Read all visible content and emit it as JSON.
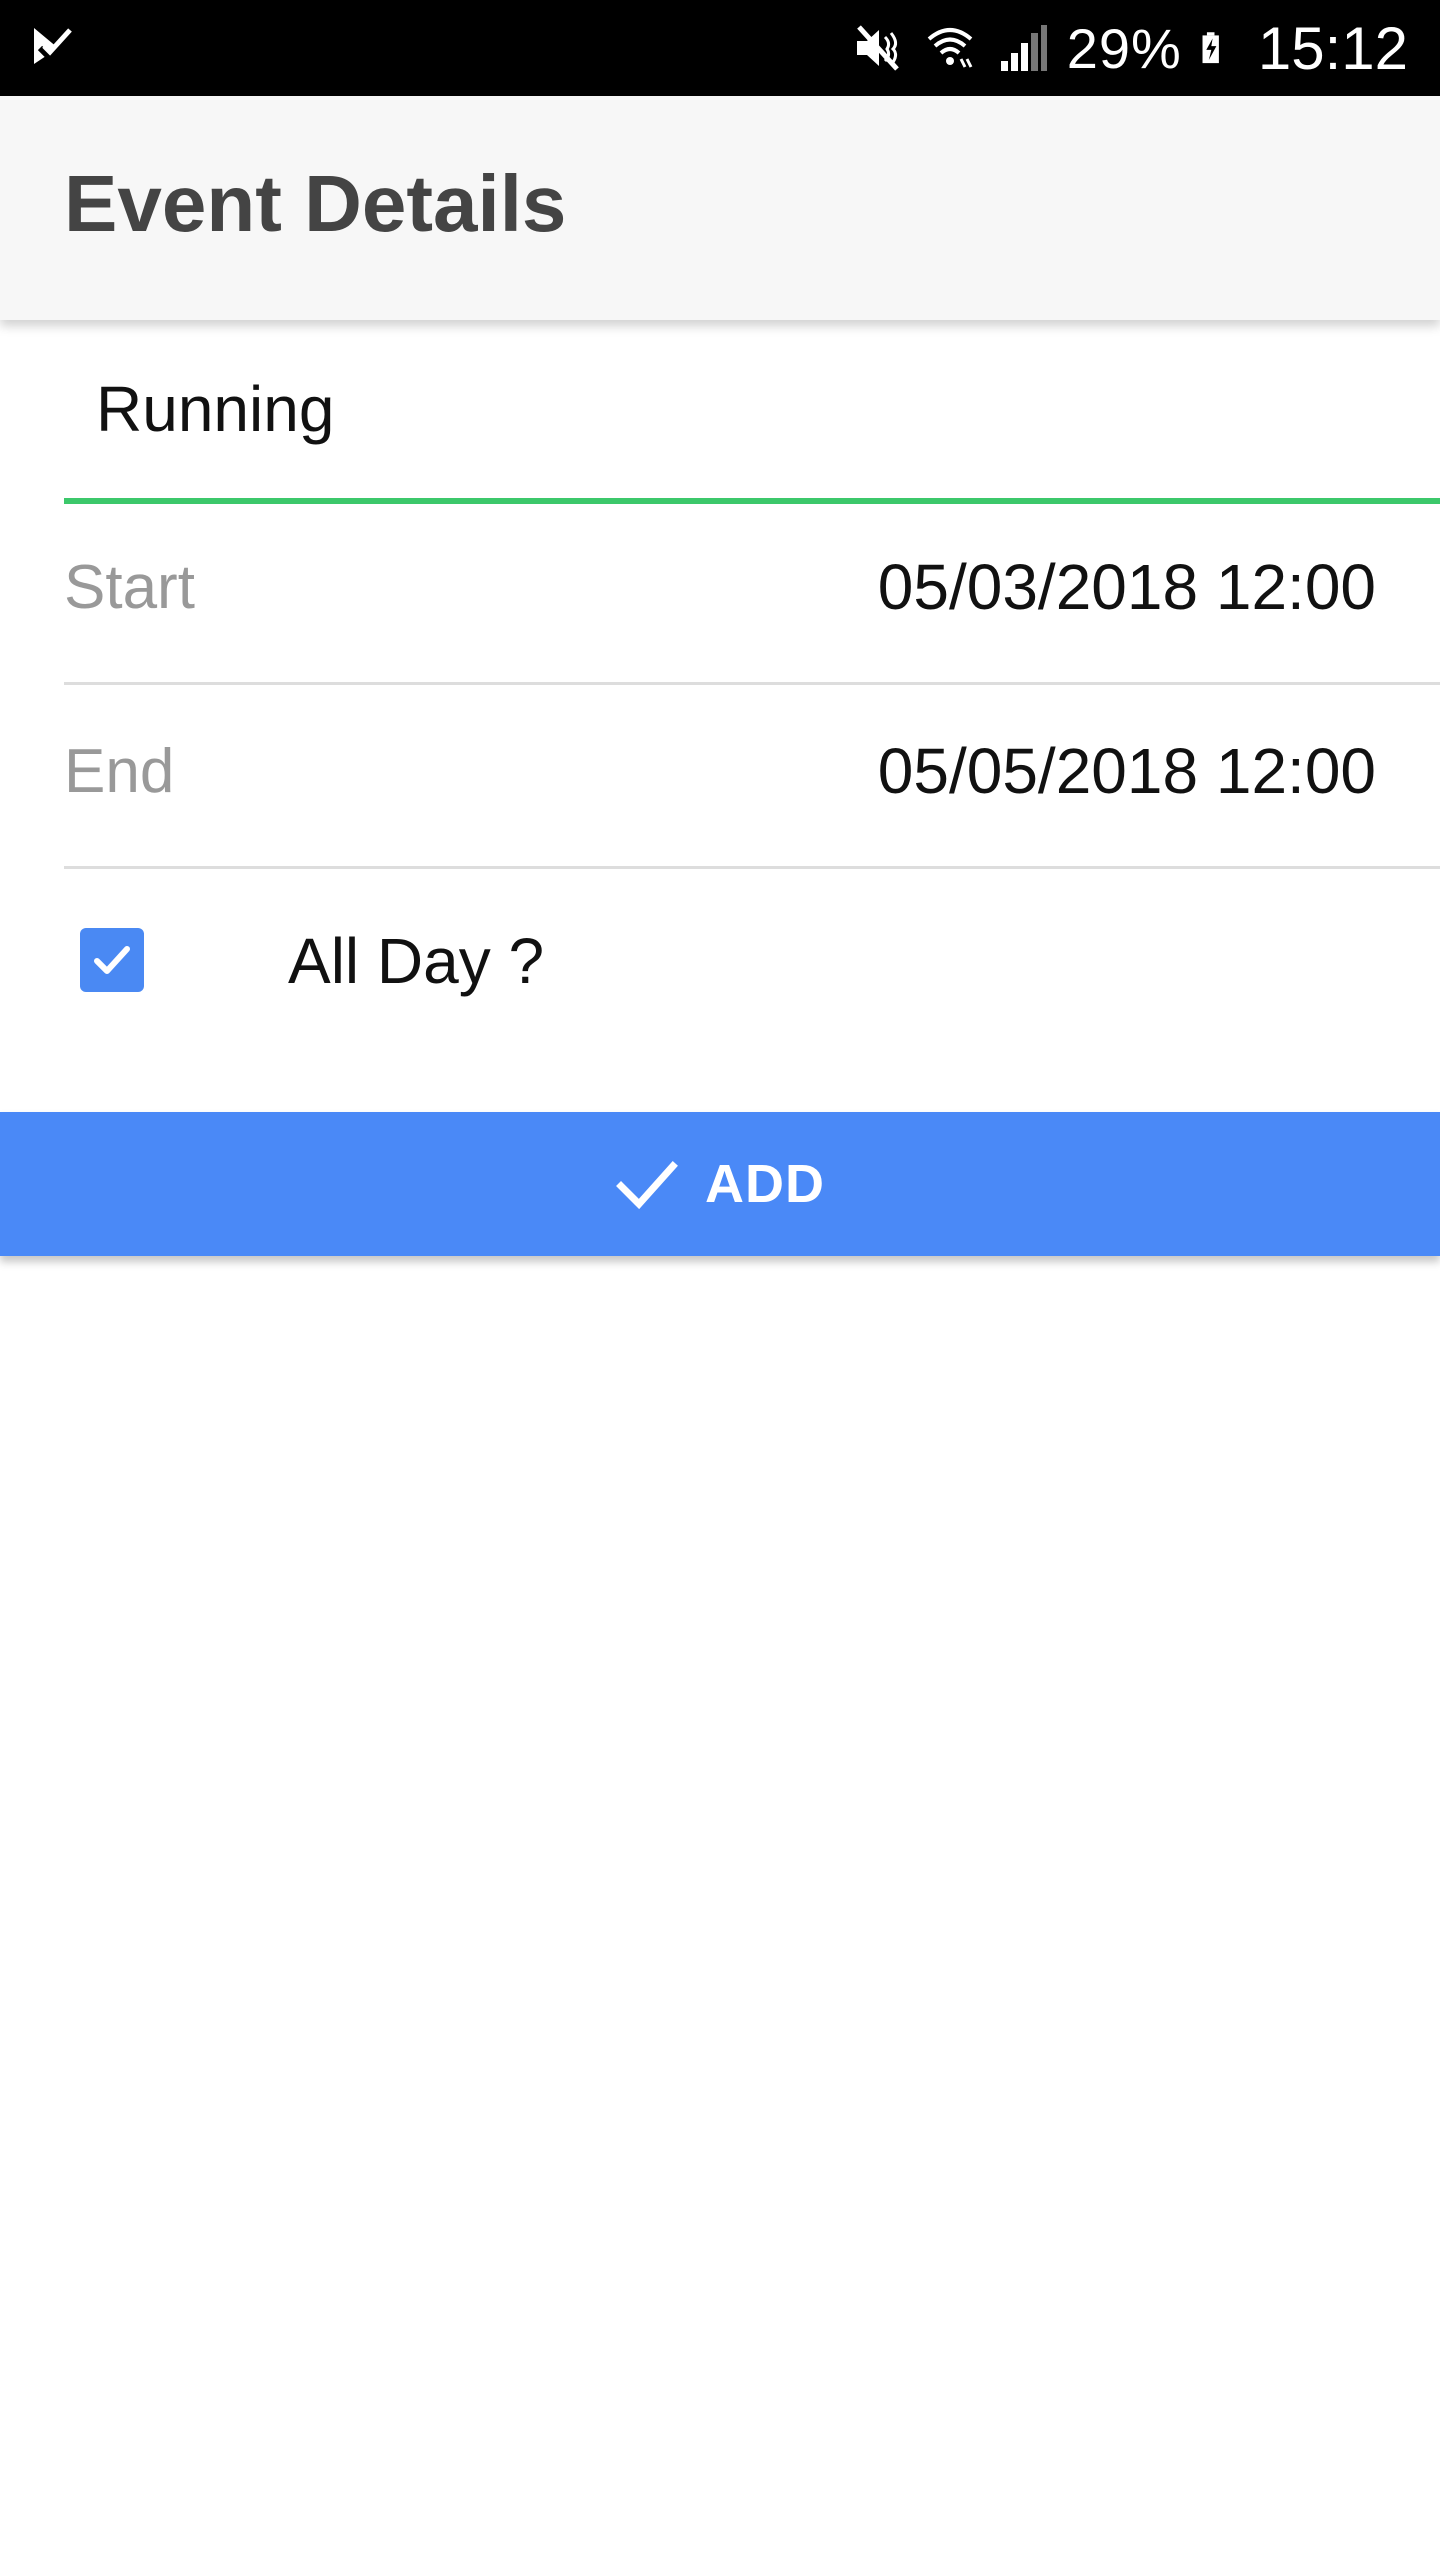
{
  "status_bar": {
    "left_icon": "app-notification-icon",
    "icons": [
      "mute-icon",
      "wifi-icon",
      "signal-icon"
    ],
    "battery_percent": "29%",
    "battery_icon": "battery-charging-icon",
    "time": "15:12"
  },
  "app_bar": {
    "title": "Event Details"
  },
  "form": {
    "title_value": "Running",
    "start_label": "Start",
    "start_value": "05/03/2018 12:00",
    "end_label": "End",
    "end_value": "05/05/2018 12:00",
    "all_day_label": "All Day ?",
    "all_day_checked": true
  },
  "add_button": {
    "icon": "check-icon",
    "label": "ADD"
  },
  "colors": {
    "status_bar": "#000000",
    "app_bar": "#f7f7f7",
    "input_underline": "#3cc86b",
    "checkbox": "#4a89f3",
    "button": "#4a89f7"
  }
}
